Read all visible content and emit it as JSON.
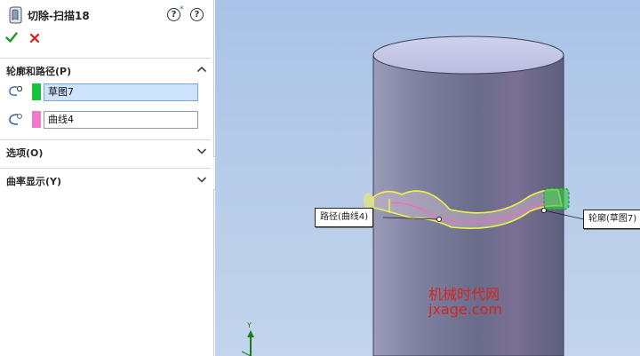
{
  "panel": {
    "title": "切除-扫描18",
    "help_label": "?",
    "star": "*"
  },
  "sections": {
    "profile_path": {
      "label": "轮廓和路径(P)",
      "profile_value": "草图7",
      "path_value": "曲线4",
      "profile_color": "#19c23a",
      "path_color": "#f07ac8"
    },
    "options": {
      "label": "选项(O)"
    },
    "curvature": {
      "label": "曲率显示(Y)"
    }
  },
  "viewport": {
    "path_callout": "路径(曲线4)",
    "profile_callout": "轮廓(草图7)",
    "watermark_cn": "机械时代网",
    "watermark_en": "jxage.com",
    "axis_y": "Y"
  },
  "colors": {
    "accent_green": "#1f9b2a",
    "cancel_red": "#d3201e",
    "selection_blue": "#cde3fb",
    "sweep_outline": "#f2f24a",
    "path_pink": "#ef6cc9",
    "background_blue": "#a9c2e6"
  }
}
